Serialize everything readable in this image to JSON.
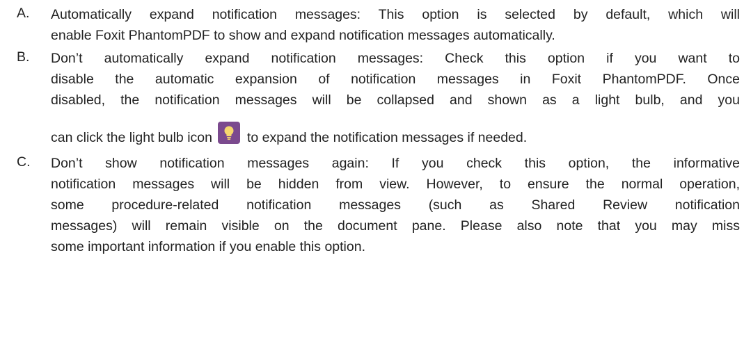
{
  "items": [
    {
      "marker": "A.",
      "lines": [
        "Automatically expand notification messages: This option is selected by default, which will",
        "enable Foxit PhantomPDF to show and expand notification messages automatically."
      ]
    },
    {
      "marker": "B.",
      "lines": [
        "Don’t automatically expand notification messages: Check this option if you want to",
        "disable the automatic expansion of notification messages in Foxit PhantomPDF. Once",
        "disabled, the notification messages will be collapsed and shown as a light bulb, and you"
      ],
      "bulb_line_before": "can click the light bulb icon",
      "bulb_line_after": "to expand the notification messages if needed.",
      "icon": "light-bulb-icon",
      "icon_bg": "#7b4a8e",
      "icon_fg": "#f5d76e"
    },
    {
      "marker": "C.",
      "lines": [
        "Don’t show notification messages again: If you check this option, the informative",
        "notification messages will be hidden from view. However, to ensure the normal operation,",
        "some procedure-related notification messages (such as Shared Review notification",
        "messages) will remain visible on the document pane. Please also note that you may miss",
        "some important information if you enable this option."
      ]
    }
  ]
}
